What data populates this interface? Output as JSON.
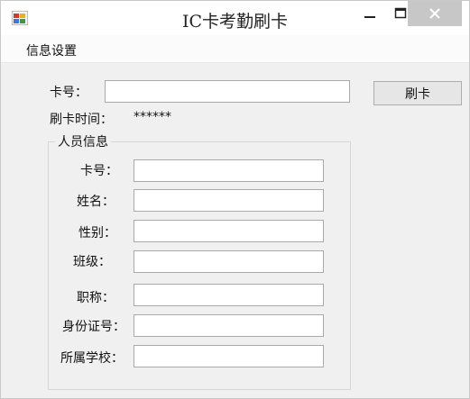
{
  "window": {
    "title": "IC卡考勤刷卡",
    "min_glyph": "—",
    "max_glyph": "☐",
    "close_glyph": "✕"
  },
  "menu": {
    "items": [
      {
        "label": "信息设置"
      }
    ]
  },
  "card": {
    "label": "卡号：",
    "value": "",
    "swipe_button": "刷卡"
  },
  "swipe_time": {
    "label": "刷卡时间：",
    "value": "******"
  },
  "person_info": {
    "title": "人员信息",
    "fields": [
      {
        "label": "卡号：",
        "value": ""
      },
      {
        "label": "姓名：",
        "value": ""
      },
      {
        "label": "性别：",
        "value": ""
      },
      {
        "label": "班级：",
        "value": ""
      },
      {
        "label": "职称：",
        "value": ""
      },
      {
        "label": "身份证号：",
        "value": ""
      },
      {
        "label": "所属学校：",
        "value": ""
      }
    ]
  },
  "colors": {
    "close_button_bg": "#c7c7c7",
    "window_bg": "#f0f0f0",
    "titlebar_bg": "#ffffff"
  },
  "icons": {
    "app": "app-icon",
    "minimize": "minimize-icon",
    "maximize": "maximize-icon",
    "close": "close-icon"
  }
}
